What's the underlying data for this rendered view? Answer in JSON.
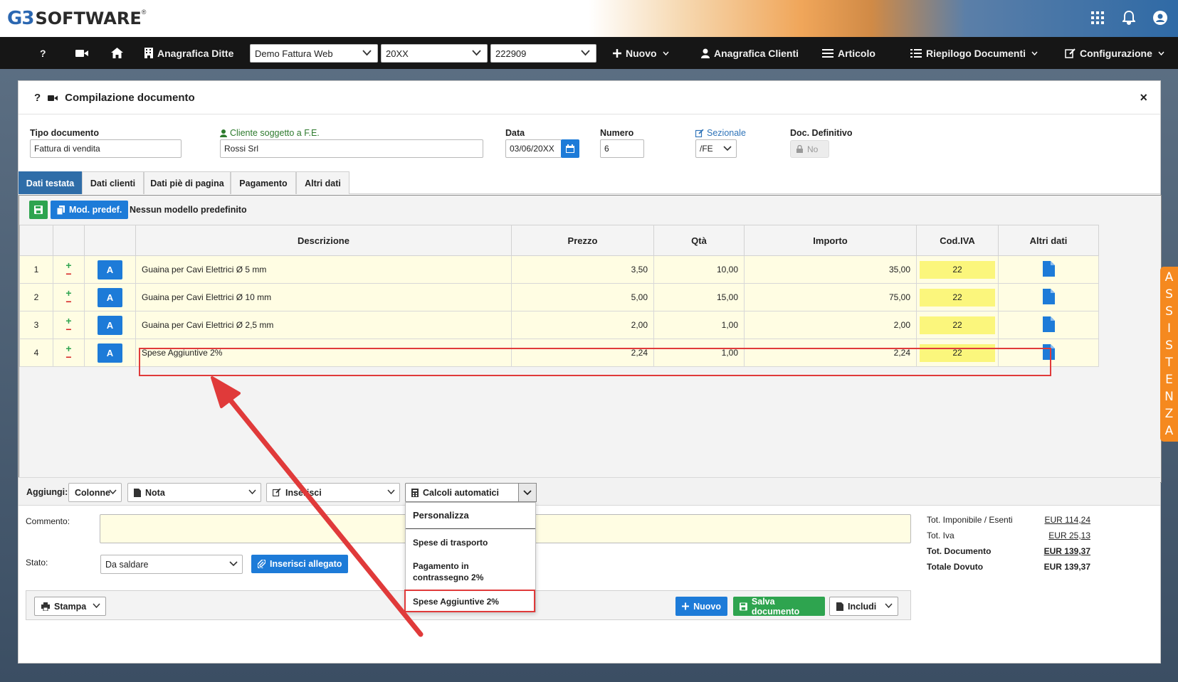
{
  "brand": {
    "logo_mark": "G3",
    "logo_text": "SOFTWARE",
    "logo_reg": "®"
  },
  "topbar_icons": [
    "grid-icon",
    "bell-icon",
    "user-icon"
  ],
  "navbar": {
    "help": "?",
    "anagrafica_ditte": "Anagrafica Ditte",
    "company_select": "Demo Fattura Web",
    "year_select": "20XX",
    "code_select": "222909",
    "nuovo": "Nuovo",
    "anagrafica_clienti": "Anagrafica Clienti",
    "articolo": "Articolo",
    "riepilogo": "Riepilogo Documenti",
    "configurazione": "Configurazione"
  },
  "modal": {
    "help": "?",
    "title": "Compilazione documento",
    "close": "×",
    "tipo_documento_label": "Tipo documento",
    "tipo_documento_value": "Fattura di vendita",
    "cliente_label": "Cliente soggetto a F.E.",
    "cliente_value": "Rossi Srl",
    "data_label": "Data",
    "data_value": "03/06/20XX",
    "numero_label": "Numero",
    "numero_value": "6",
    "sezionale_label": "Sezionale",
    "sezionale_value": "/FE",
    "doc_definitivo_label": "Doc. Definitivo",
    "doc_definitivo_value": "No"
  },
  "tabs": [
    "Dati testata",
    "Dati clienti",
    "Dati piè di pagina",
    "Pagamento",
    "Altri dati"
  ],
  "model_bar": {
    "mod_predef": "Mod. predef.",
    "nessun_modello": "Nessun modello predefinito"
  },
  "table": {
    "headers": {
      "descrizione": "Descrizione",
      "prezzo": "Prezzo",
      "qta": "Qtà",
      "importo": "Importo",
      "cod_iva": "Cod.IVA",
      "altri_dati": "Altri dati"
    },
    "rows": [
      {
        "n": "1",
        "btn": "A",
        "desc": "Guaina per Cavi Elettrici Ø 5 mm",
        "prezzo": "3,50",
        "qta": "10,00",
        "importo": "35,00",
        "iva": "22"
      },
      {
        "n": "2",
        "btn": "A",
        "desc": "Guaina per Cavi Elettrici Ø 10 mm",
        "prezzo": "5,00",
        "qta": "15,00",
        "importo": "75,00",
        "iva": "22"
      },
      {
        "n": "3",
        "btn": "A",
        "desc": "Guaina per Cavi Elettrici Ø 2,5 mm",
        "prezzo": "2,00",
        "qta": "1,00",
        "importo": "2,00",
        "iva": "22"
      },
      {
        "n": "4",
        "btn": "A",
        "desc": "Spese Aggiuntive 2%",
        "prezzo": "2,24",
        "qta": "1,00",
        "importo": "2,24",
        "iva": "22"
      }
    ]
  },
  "addbar": {
    "label": "Aggiungi:",
    "colonne": "Colonne",
    "nota": "Nota",
    "inserisci": "Inserisci",
    "calcoli": "Calcoli automatici"
  },
  "dropdown": {
    "head": "Personalizza",
    "items": [
      "Spese di trasporto",
      "Pagamento in contrassegno 2%",
      "Spese Aggiuntive 2%"
    ]
  },
  "bottom": {
    "commento_label": "Commento:",
    "stato_label": "Stato:",
    "stato_value": "Da saldare",
    "inserisci_allegato": "Inserisci allegato"
  },
  "totals": {
    "imponibile_label": "Tot. Imponibile / Esenti",
    "imponibile_value": "EUR 114,24",
    "iva_label": "Tot. Iva",
    "iva_value": "EUR 25,13",
    "documento_label": "Tot. Documento",
    "documento_value": "EUR 139,37",
    "dovuto_label": "Totale Dovuto",
    "dovuto_value": "EUR 139,37"
  },
  "actions": {
    "stampa": "Stampa",
    "nuovo": "Nuovo",
    "salva": "Salva documento",
    "includi": "Includi"
  },
  "assistenza": [
    "A",
    "S",
    "S",
    "I",
    "S",
    "T",
    "E",
    "N",
    "Z",
    "A"
  ],
  "colors": {
    "primary_blue": "#1d7bd8",
    "success_green": "#2ea44f",
    "highlight_red": "#e03a3a",
    "assist_orange": "#f5891f",
    "row_yellow": "#fffde3",
    "iva_yellow": "#fbf67c"
  }
}
